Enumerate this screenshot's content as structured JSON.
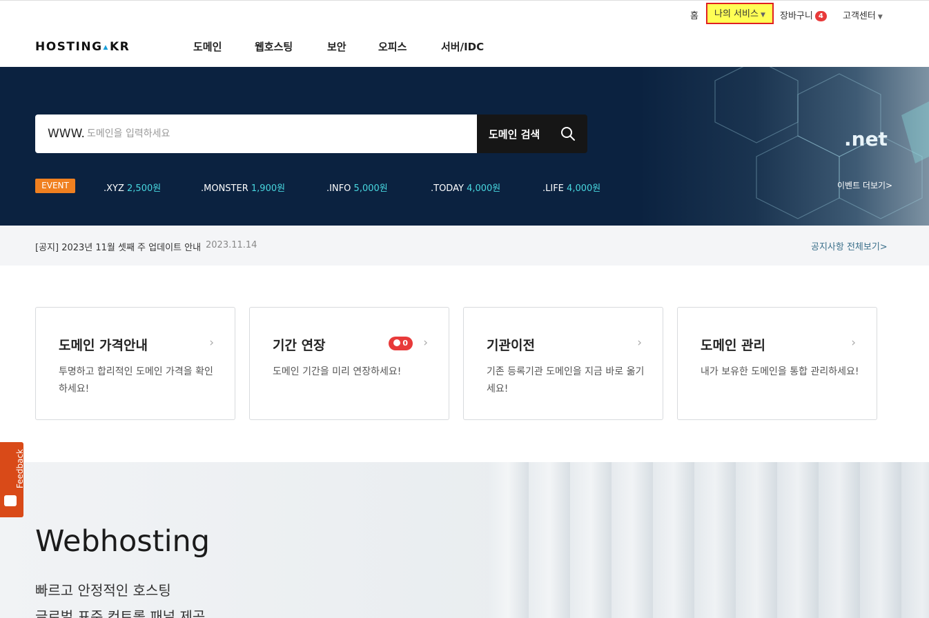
{
  "util": {
    "home": "홈",
    "my_service": "나의 서비스",
    "cart": "장바구니",
    "cart_count": "4",
    "support": "고객센터"
  },
  "logo": {
    "left": "HOSTING",
    "right": "KR"
  },
  "nav": [
    "도메인",
    "웹호스팅",
    "보안",
    "오피스",
    "서버/IDC"
  ],
  "hero": {
    "prefix": "WWW.",
    "placeholder": "도메인을 입력하세요",
    "search_button": "도메인 검색",
    "event_label": "EVENT",
    "promos": [
      {
        "tld": ".XYZ",
        "price": "2,500원"
      },
      {
        "tld": ".MONSTER",
        "price": "1,900원"
      },
      {
        "tld": ".INFO",
        "price": "5,000원"
      },
      {
        "tld": ".TODAY",
        "price": "4,000원"
      },
      {
        "tld": ".LIFE",
        "price": "4,000원"
      }
    ],
    "banner_tld": ".net",
    "event_more": "이벤트 더보기>"
  },
  "notice": {
    "text": "[공지] 2023년 11월 셋째 주 업데이트 안내",
    "date": "2023.11.14",
    "more": "공지사항 전체보기>"
  },
  "cards": [
    {
      "title": "도메인 가격안내",
      "desc": "투명하고 합리적인 도메인 가격을 확인하세요!"
    },
    {
      "title": "기간 연장",
      "desc": "도메인 기간을 미리 연장하세요!",
      "count": "0"
    },
    {
      "title": "기관이전",
      "desc": "기존 등록기관 도메인을 지금 바로 옮기세요!"
    },
    {
      "title": "도메인 관리",
      "desc": "내가 보유한 도메인을 통합 관리하세요!"
    }
  ],
  "webhosting": {
    "title": "Webhosting",
    "line1": "빠르고 안정적인 호스팅",
    "line2": "글로벌 표준 컨트롤 패널 제공"
  },
  "feedback": "Feedback",
  "colors": {
    "hero_bg": "#0b2240",
    "accent_price": "#48d8e0",
    "event_orange": "#f08020",
    "badge_red": "#e83a3a",
    "feedback_orange": "#d94a18"
  }
}
